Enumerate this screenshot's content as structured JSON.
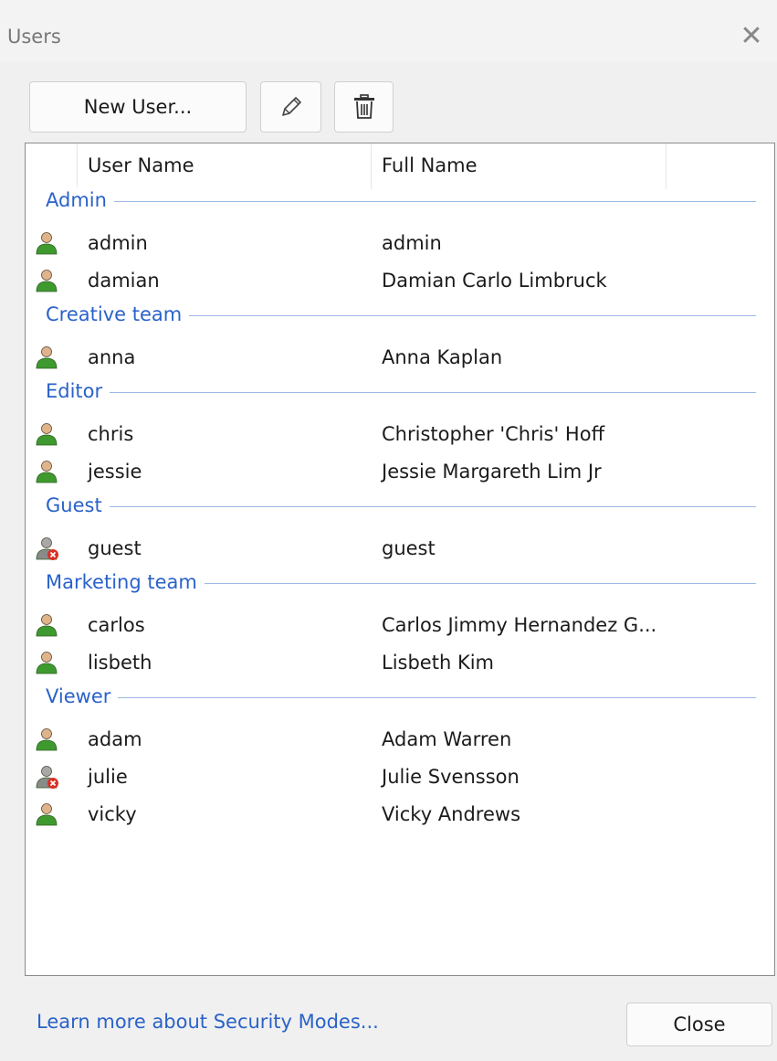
{
  "window": {
    "title": "Users",
    "close_glyph": "✕"
  },
  "toolbar": {
    "new_user_label": "New User...",
    "edit_icon": "pencil-icon",
    "delete_icon": "trash-icon"
  },
  "columns": [
    "User Name",
    "Full Name"
  ],
  "colors": {
    "group_text": "#2a62c9",
    "group_line": "#9db8e4",
    "user_active": "#3e9a2e",
    "user_disabled": "#8a8a8a",
    "disabled_badge": "#d93025"
  },
  "groups": [
    {
      "name": "Admin",
      "users": [
        {
          "username": "admin",
          "fullname": "admin",
          "status": "active"
        },
        {
          "username": "damian",
          "fullname": "Damian Carlo Limbruck",
          "status": "active"
        }
      ]
    },
    {
      "name": "Creative team",
      "users": [
        {
          "username": "anna",
          "fullname": "Anna Kaplan",
          "status": "active"
        }
      ]
    },
    {
      "name": "Editor",
      "users": [
        {
          "username": "chris",
          "fullname": "Christopher 'Chris' Hoff",
          "status": "active"
        },
        {
          "username": "jessie",
          "fullname": "Jessie Margareth Lim Jr",
          "status": "active"
        }
      ]
    },
    {
      "name": "Guest",
      "users": [
        {
          "username": "guest",
          "fullname": "guest",
          "status": "disabled"
        }
      ]
    },
    {
      "name": "Marketing team",
      "users": [
        {
          "username": "carlos",
          "fullname": "Carlos Jimmy Hernandez G...",
          "status": "active"
        },
        {
          "username": "lisbeth",
          "fullname": "Lisbeth Kim",
          "status": "active"
        }
      ]
    },
    {
      "name": "Viewer",
      "users": [
        {
          "username": "adam",
          "fullname": "Adam Warren",
          "status": "active"
        },
        {
          "username": "julie",
          "fullname": "Julie Svensson",
          "status": "disabled"
        },
        {
          "username": "vicky",
          "fullname": "Vicky Andrews",
          "status": "active"
        }
      ]
    }
  ],
  "footer": {
    "learn_more_label": "Learn more about Security Modes...",
    "close_label": "Close"
  }
}
